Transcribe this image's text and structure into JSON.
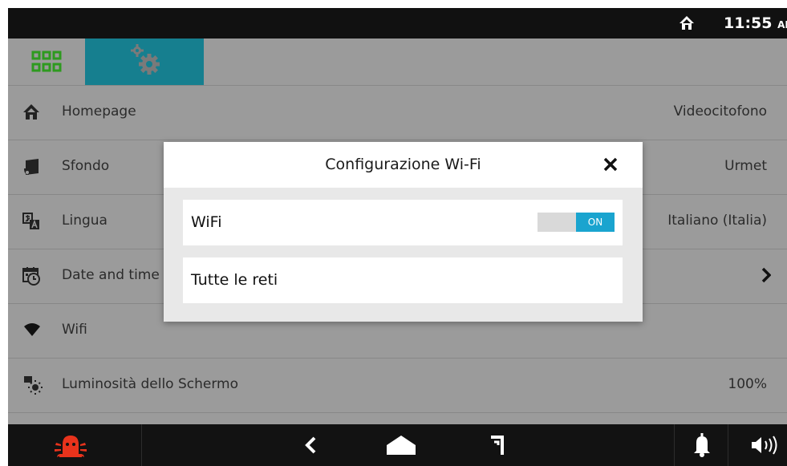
{
  "status_bar": {
    "time": "11:55",
    "ampm": "AM",
    "home_icon": "home-icon"
  },
  "tabs": [
    {
      "name": "apps",
      "icon": "apps-grid-icon",
      "active": false
    },
    {
      "name": "settings",
      "icon": "gears-icon",
      "active": true
    }
  ],
  "settings": [
    {
      "label": "Homepage",
      "value": "Videocitofono",
      "icon": "home-icon"
    },
    {
      "label": "Sfondo",
      "value": "Urmet",
      "icon": "wallpaper-icon"
    },
    {
      "label": "Lingua",
      "value": "Italiano (Italia)",
      "icon": "language-icon"
    },
    {
      "label": "Date and time",
      "value": "",
      "icon": "calendar-clock-icon"
    },
    {
      "label": "Wifi",
      "value": "",
      "icon": "wifi-icon"
    },
    {
      "label": "Luminosità dello Schermo",
      "value": "100%",
      "icon": "brightness-icon"
    }
  ],
  "dialog": {
    "title": "Configurazione Wi-Fi",
    "wifi_label": "WiFi",
    "toggle_state": "ON",
    "networks_label": "Tutte le reti"
  },
  "nav": {
    "alarm_icon": "alarm-icon",
    "back_icon": "back-icon",
    "home_icon": "home-icon",
    "recent_icon": "recent-icon",
    "bell_icon": "bell-icon",
    "volume_icon": "volume-icon"
  },
  "colors": {
    "active_tab": "#167f8f",
    "toggle_on": "#1aa4cf",
    "alarm": "#e8331c"
  }
}
